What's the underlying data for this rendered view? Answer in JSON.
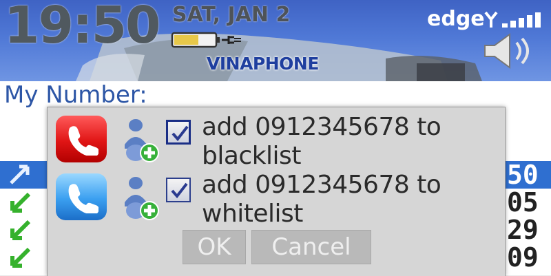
{
  "status_bar": {
    "time": "19:50",
    "date": "SAT, JAN 2",
    "carrier": "VINAPHONE",
    "network": "edge",
    "battery_level": 0.6
  },
  "main": {
    "my_number_label": "My Number:",
    "my_number_value": "",
    "list_rows": [
      {
        "digits": "50",
        "selected": true
      },
      {
        "digits": "05",
        "selected": false
      },
      {
        "digits": "29",
        "selected": false
      },
      {
        "digits": "09",
        "selected": false
      }
    ]
  },
  "dialog": {
    "options": [
      {
        "text": "add 0912345678 to blacklist",
        "checked": true,
        "icon": "red-phone-icon"
      },
      {
        "text": "add 0912345678 to whitelist",
        "checked": true,
        "icon": "blue-phone-icon"
      }
    ],
    "ok_label": "OK",
    "cancel_label": "Cancel"
  },
  "colors": {
    "banner": "#4f78d6",
    "list_selected": "#2f6fd0",
    "my_number_text": "#2d56a6",
    "dialog_bg": "#d6d6d6"
  }
}
